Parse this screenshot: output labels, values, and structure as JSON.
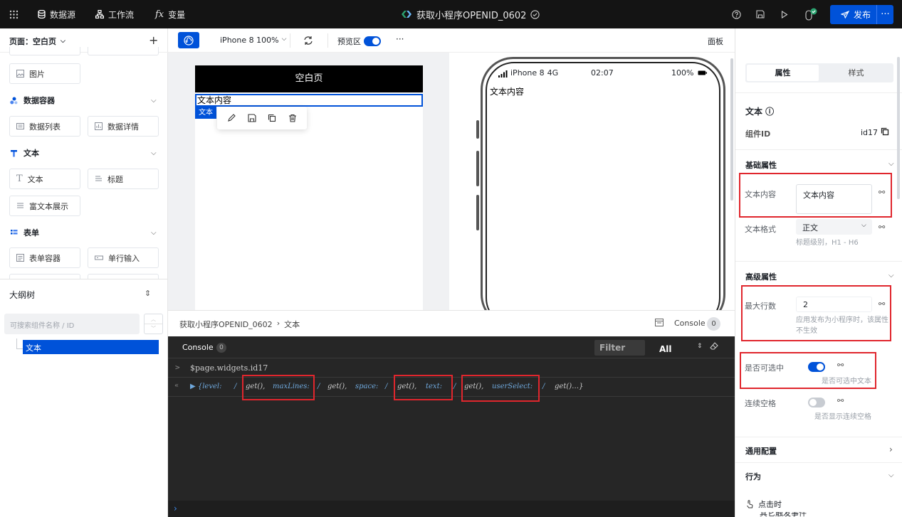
{
  "topbar": {
    "nav": [
      "数据源",
      "工作流",
      "变量"
    ],
    "app_title": "获取小程序OPENID_0602",
    "publish_label": "发布",
    "more_label": "···"
  },
  "left_panel": {
    "page_label": "页面：空白页",
    "add_label": "+",
    "sections": [
      {
        "title": "数据容器",
        "items": [
          "数据列表",
          "数据详情"
        ]
      },
      {
        "title": "文本",
        "items": [
          "文本",
          "标题",
          "富文本展示"
        ]
      },
      {
        "title": "表单",
        "items": [
          "表单容器",
          "单行输入"
        ]
      }
    ],
    "image_item": "图片",
    "outline_title": "大纲树",
    "search_placeholder": "可搜索组件名称 / ID",
    "tree_selected": "文本"
  },
  "center_toolbar": {
    "device": "iPhone 8 100%",
    "preview_label": "预览区",
    "more": "···",
    "panel_label": "面板"
  },
  "canvas": {
    "page_title": "空白页",
    "text_content": "文本内容",
    "selected_tag": "文本",
    "phone_carrier": "iPhone 8",
    "phone_network": "4G",
    "phone_time": "02:07",
    "phone_battery": "100%",
    "phone_text": "文本内容"
  },
  "breadcrumb": {
    "items": [
      "获取小程序OPENID_0602",
      "文本"
    ],
    "console_label": "Console",
    "console_count": "0"
  },
  "console": {
    "tab_label": "Console",
    "tab_count": "0",
    "filter_placeholder": "Filter",
    "level": "All",
    "lines": [
      {
        "prompt": ">",
        "text": "$page.widgets.id17"
      },
      {
        "prompt": "«",
        "tokens": [
          "▶ {level:",
          "/",
          "get(),",
          "maxLines:",
          "/",
          "get(),",
          "space:",
          "/",
          "get(),",
          "text:",
          "/",
          "get(),",
          "userSelect:",
          "/",
          "get()…}"
        ]
      }
    ],
    "input_prompt": "›"
  },
  "right_panel": {
    "tabs": [
      "属性",
      "样式"
    ],
    "component_name": "文本 ⓘ",
    "component_id_label": "组件ID",
    "component_id": "id17",
    "basic_title": "基础属性",
    "text_content_label": "文本内容",
    "text_content_value": "文本内容",
    "text_format_label": "文本格式",
    "text_format_value": "正文",
    "text_format_hint": "标题级别，H1 - H6",
    "advanced_title": "高级属性",
    "max_lines_label": "最大行数",
    "max_lines_value": "2",
    "max_lines_hint": "应用发布为小程序时，该属性不生效",
    "selectable_label": "是否可选中",
    "selectable_hint": "是否可选中文本",
    "spaces_label": "连续空格",
    "spaces_hint": "是否显示连续空格",
    "general_title": "通用配置",
    "behavior_title": "行为",
    "on_click": "点击时",
    "cutoff_text": "其它触发事件"
  },
  "colors": {
    "accent": "#0052d9",
    "highlight": "#e0262d",
    "console_bg": "#262626"
  }
}
